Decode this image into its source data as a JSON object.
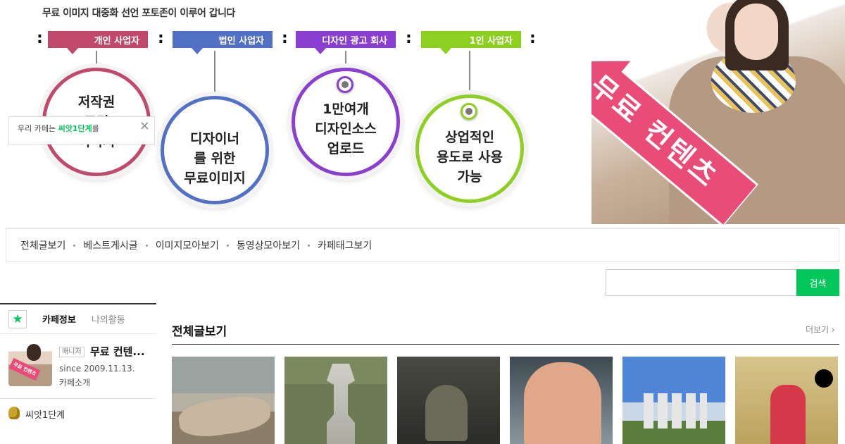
{
  "banner": {
    "headline": "무료 이미지 대중화 선언 포토존이 이루어 갑니다",
    "tags": [
      "개인 사업자",
      "법인 사업자",
      "디자인 광고 회사",
      "1인 사업자"
    ],
    "separator": ":",
    "circles": [
      "저작권\n프리\n이미지",
      "디자이너\n를 위한\n무료이미지",
      "1만여개\n디자인소스\n업로드",
      "상업적인\n용도로 사용\n가능"
    ],
    "arrow_text": "무료 컨텐츠",
    "colors": {
      "pink": "#c14a6c",
      "blue": "#5370c7",
      "purple": "#8b3fd0",
      "green": "#8ed022",
      "arrow": "#e94c77"
    }
  },
  "nav": {
    "items": [
      "전체글보기",
      "베스트게시글",
      "이미지모아보기",
      "동영상모아보기",
      "카페태그보기"
    ]
  },
  "search": {
    "placeholder": "",
    "button_label": "검색",
    "accent": "#03c75a"
  },
  "sidebar": {
    "star_icon": "★",
    "tabs": [
      "카페정보",
      "나의활동"
    ],
    "profile": {
      "avatar_text": "무료 컨텐츠",
      "role": "매니저",
      "name": "무료 컨텐...",
      "since": "since 2009.11.13.",
      "intro_link": "카페소개"
    },
    "level": "씨앗1단계",
    "notice": {
      "prefix": "우리 카페는",
      "level": "씨앗1단계",
      "suffix": "를",
      "close_icon": "×"
    }
  },
  "main": {
    "title": "전체글보기",
    "more_label": "더보기 ›",
    "thumbnails": [
      "stone-statue",
      "stone-lantern",
      "bronze-bell",
      "man-portrait",
      "city-skyline",
      "hanbok-woman"
    ]
  }
}
